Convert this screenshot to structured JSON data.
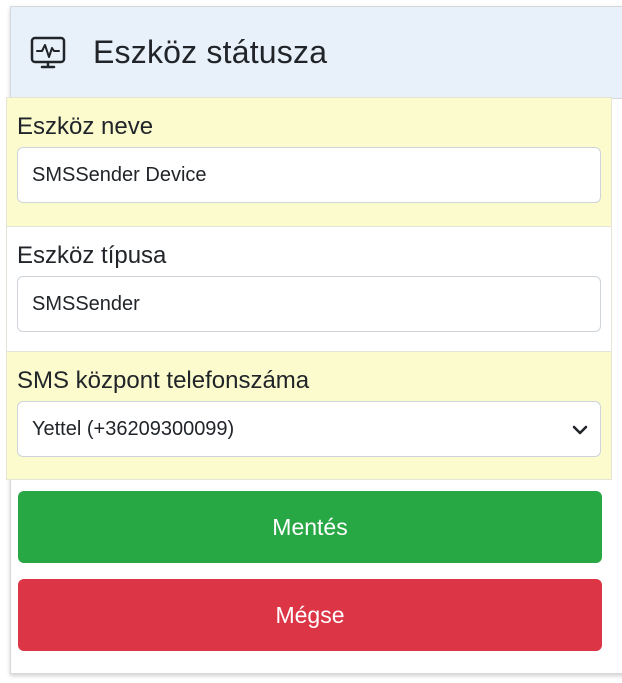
{
  "header": {
    "title": "Eszköz státusza",
    "icon": "monitor-heartbeat-icon"
  },
  "form": {
    "device_name": {
      "label": "Eszköz neve",
      "value": "SMSSender Device"
    },
    "device_type": {
      "label": "Eszköz típusa",
      "value": "SMSSender"
    },
    "sms_center": {
      "label": "SMS központ telefonszáma",
      "selected": "Yettel (+36209300099)"
    }
  },
  "buttons": {
    "save_label": "Mentés",
    "cancel_label": "Mégse"
  },
  "colors": {
    "header_bg": "#e8f1fa",
    "highlight_row_bg": "#fbfbce",
    "save": "#28a745",
    "cancel": "#dc3545"
  }
}
